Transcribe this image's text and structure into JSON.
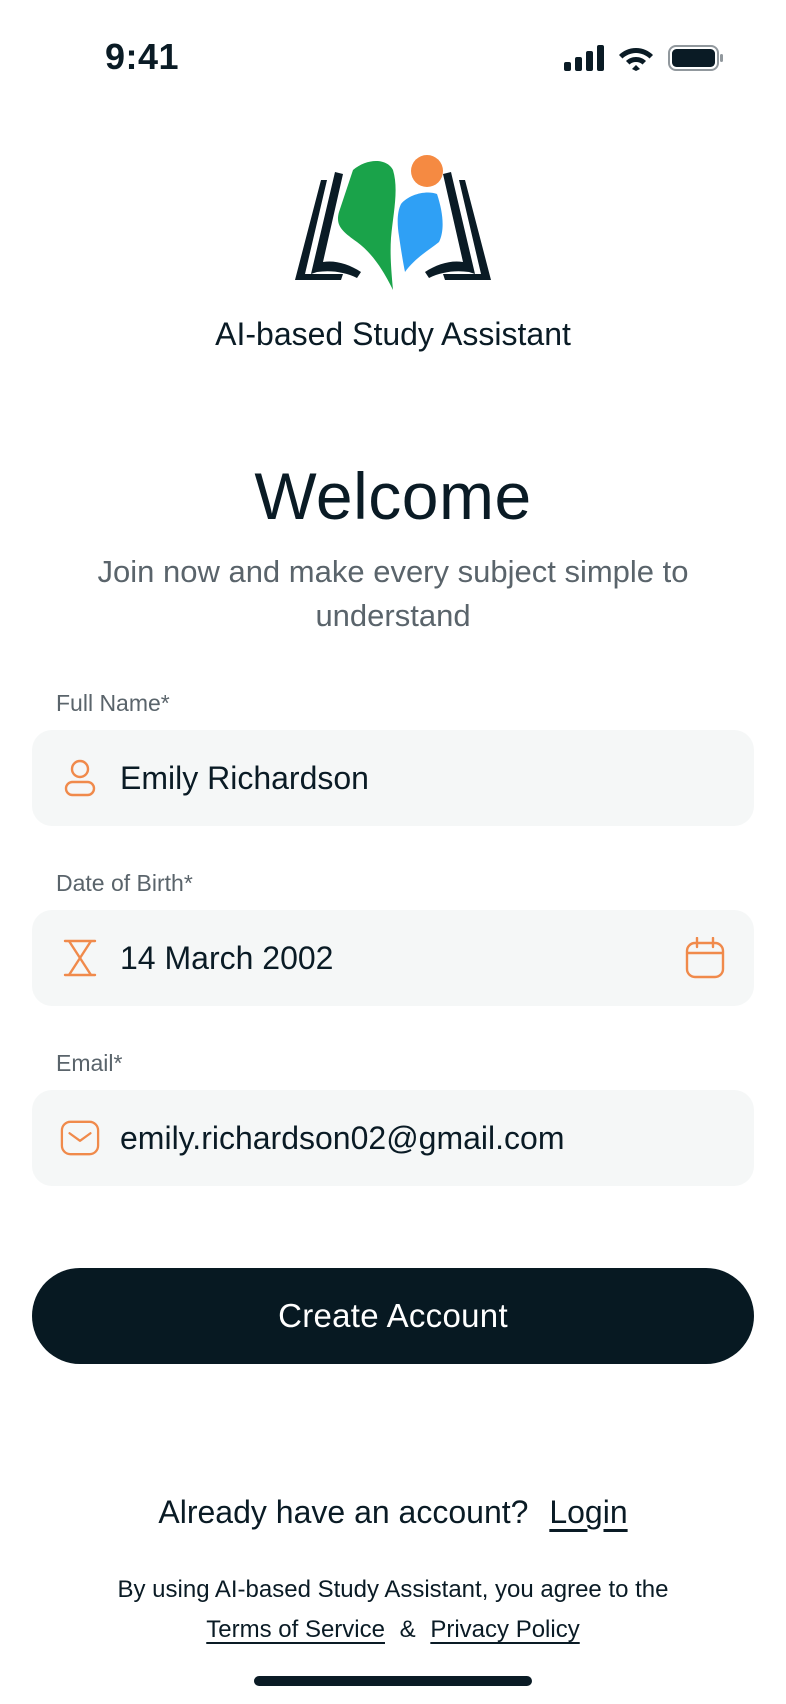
{
  "status_bar": {
    "time": "9:41"
  },
  "app": {
    "name": "AI-based Study Assistant"
  },
  "header": {
    "title": "Welcome",
    "subtitle": "Join now and make every subject simple to understand"
  },
  "form": {
    "full_name": {
      "label": "Full Name*",
      "value": "Emily Richardson",
      "icon": "user-icon"
    },
    "dob": {
      "label": "Date of Birth*",
      "value": "14 March 2002",
      "icon": "hourglass-icon",
      "trailing_icon": "calendar-icon"
    },
    "email": {
      "label": "Email*",
      "value": "emily.richardson02@gmail.com",
      "icon": "mail-icon"
    }
  },
  "actions": {
    "create_account": "Create Account"
  },
  "footer": {
    "have_account": "Already have an account?",
    "login": "Login",
    "agree_text": "By using AI-based Study Assistant, you agree to the",
    "terms": "Terms of Service",
    "amp": "&",
    "privacy": "Privacy Policy"
  },
  "colors": {
    "accent": "#f08a4b",
    "primary_dark": "#071922",
    "field_bg": "#f5f7f7",
    "logo_green": "#1aa34a",
    "logo_blue": "#2fa0f5",
    "logo_orange": "#f58a42"
  }
}
